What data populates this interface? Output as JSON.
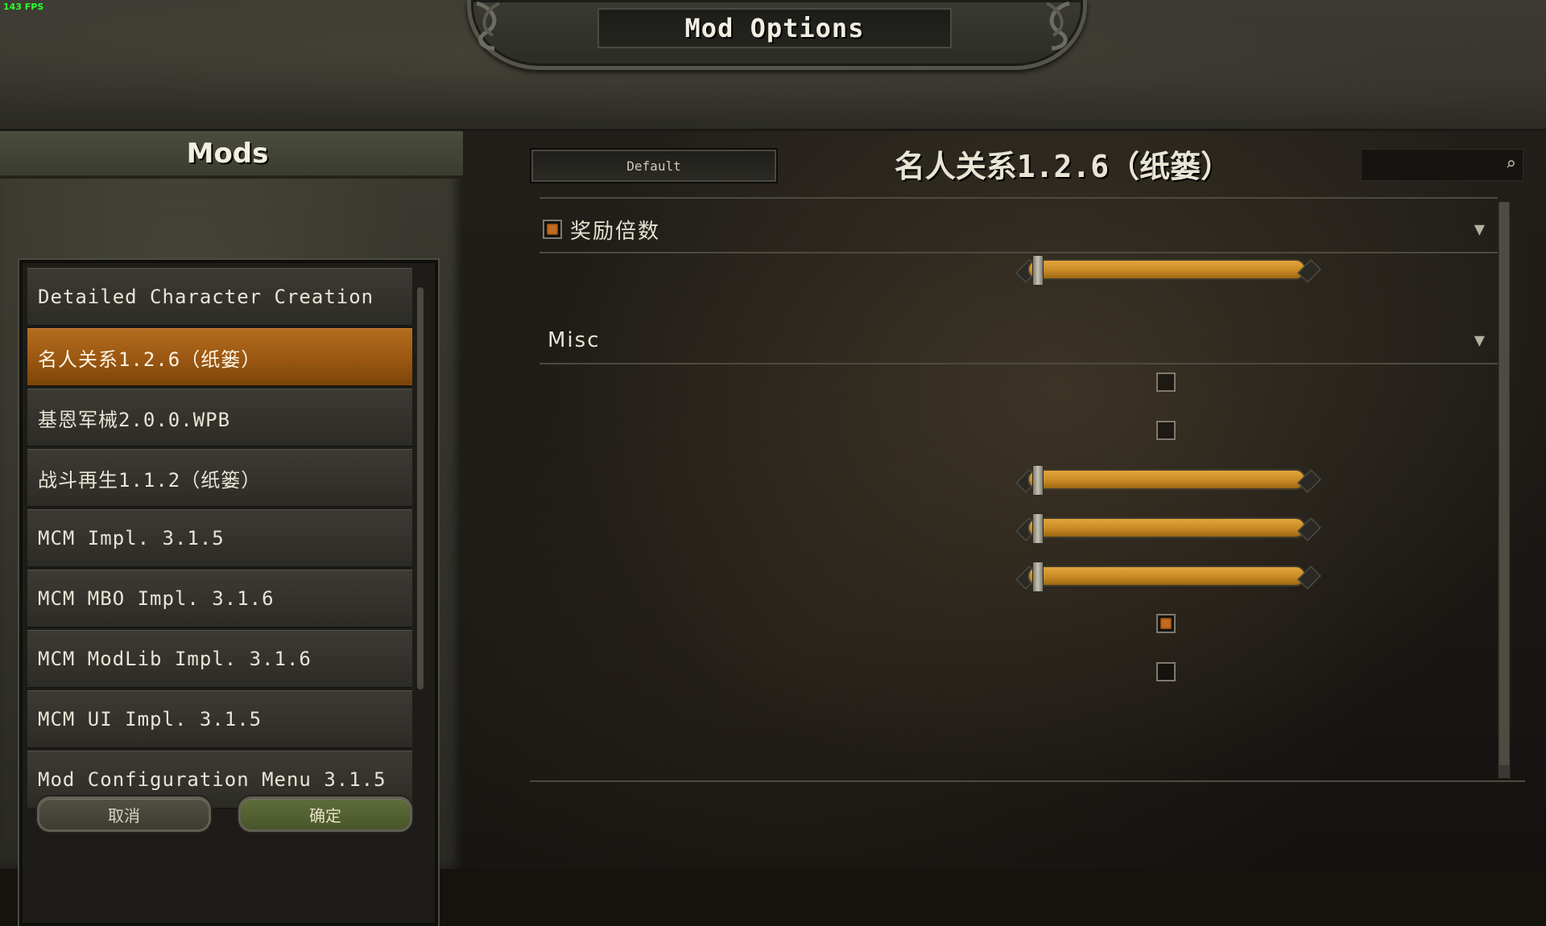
{
  "overlay": {
    "fps": "143 FPS"
  },
  "window": {
    "title": "Mod Options"
  },
  "sidebar": {
    "heading": "Mods",
    "mods": [
      {
        "label": "Detailed Character Creation",
        "selected": false
      },
      {
        "label": "名人关系1.2.6（纸篓）",
        "selected": true
      },
      {
        "label": "基恩军械2.0.0.WPB",
        "selected": false
      },
      {
        "label": "战斗再生1.1.2（纸篓）",
        "selected": false
      },
      {
        "label": "MCM Impl. 3.1.5",
        "selected": false
      },
      {
        "label": "MCM MBO Impl. 3.1.6",
        "selected": false
      },
      {
        "label": "MCM ModLib Impl. 3.1.6",
        "selected": false
      },
      {
        "label": "MCM UI Impl. 3.1.5",
        "selected": false
      },
      {
        "label": "Mod Configuration Menu 3.1.5",
        "selected": false
      }
    ],
    "cancel_label": "取消",
    "confirm_label": "确定"
  },
  "settings": {
    "preset_label": "Default",
    "mod_title": "名人关系1.2.6（纸篓）",
    "search": {
      "value": "",
      "icon": "search-icon"
    },
    "groups": [
      {
        "label": "奖励倍数",
        "toggle_checked": true,
        "chevron": "chevron-down-icon"
      },
      {
        "label": "Misc",
        "chevron": "chevron-down-icon"
      }
    ],
    "controls": [
      {
        "type": "slider",
        "group": 0,
        "fill": 1.0
      },
      {
        "type": "checkbox",
        "group": 1,
        "checked": false
      },
      {
        "type": "checkbox",
        "group": 1,
        "checked": false
      },
      {
        "type": "slider",
        "group": 1,
        "fill": 1.0
      },
      {
        "type": "slider",
        "group": 1,
        "fill": 1.0
      },
      {
        "type": "slider",
        "group": 1,
        "fill": 1.0
      },
      {
        "type": "checkbox",
        "group": 1,
        "checked": true
      },
      {
        "type": "checkbox",
        "group": 1,
        "checked": false
      }
    ]
  },
  "colors": {
    "accent": "#b36b1e",
    "slider_fill": "#d89a34",
    "checked": "#c46a1c"
  }
}
